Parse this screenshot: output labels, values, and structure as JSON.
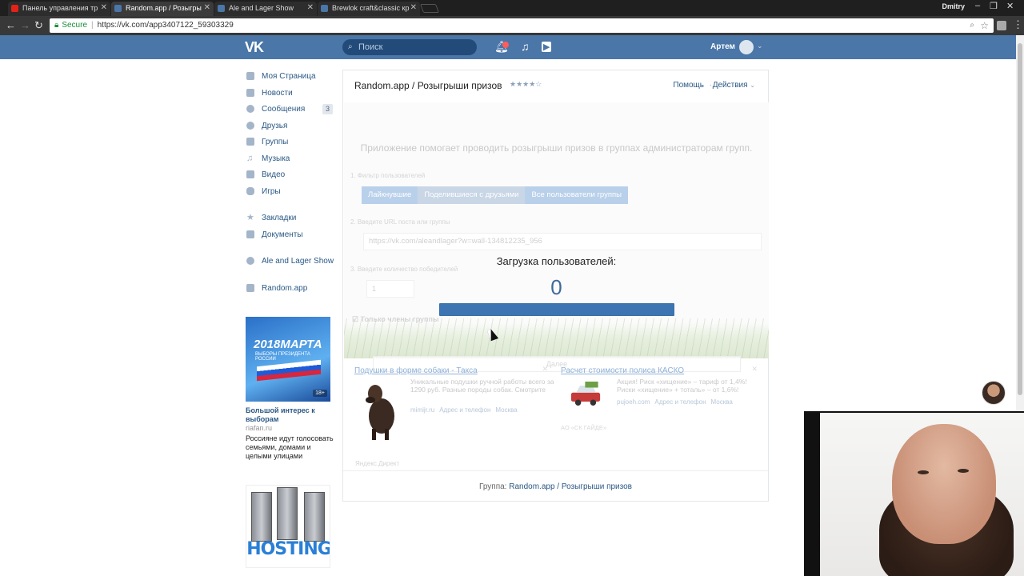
{
  "browser": {
    "tabs": [
      {
        "title": "Панель управления тр",
        "color": "#e62117"
      },
      {
        "title": "Random.app / Розыгры",
        "color": "#4a76a8"
      },
      {
        "title": "Ale and Lager Show",
        "color": "#4a76a8"
      },
      {
        "title": "Brewlok craft&classic кр",
        "color": "#4a76a8"
      }
    ],
    "active_tab": 1,
    "user": "Dmitry",
    "secure_label": "Secure",
    "url": "https://vk.com/app3407122_59303329"
  },
  "vk_header": {
    "logo": "VK",
    "search_placeholder": "Поиск",
    "user_name": "Артем"
  },
  "nav": {
    "items": [
      {
        "label": "Моя Страница"
      },
      {
        "label": "Новости"
      },
      {
        "label": "Сообщения",
        "badge": "3"
      },
      {
        "label": "Друзья"
      },
      {
        "label": "Группы"
      },
      {
        "label": "Музыка"
      },
      {
        "label": "Видео"
      },
      {
        "label": "Игры"
      }
    ],
    "items2": [
      {
        "label": "Закладки"
      },
      {
        "label": "Документы"
      }
    ],
    "items3": [
      {
        "label": "Ale and Lager Show"
      }
    ],
    "items4": [
      {
        "label": "Random.app"
      }
    ]
  },
  "left_ads": {
    "banner_big": "2018МАРТА",
    "banner_small": "ВЫБОРЫ ПРЕЗИДЕНТА РОССИИ",
    "banner_age": "18+",
    "title": "Большой интерес к выборам",
    "domain": "riafan.ru",
    "desc": "Россияне идут голосовать семьями, домами и целыми улицами",
    "hosting_word": "HOSTING"
  },
  "app": {
    "title": "Random.app / Розыгрыши призов",
    "stars": "★★★★☆",
    "help": "Помощь",
    "actions": "Действия",
    "description": "Приложение помогает проводить розыгрыши призов в группах администраторам групп.",
    "step1": "1. Фильтр пользователей",
    "filters": [
      "Лайкнувшие",
      "Поделившиеся с друзьями",
      "Все пользователи группы"
    ],
    "step2": "2. Введите URL поста или группы",
    "url_value": "https://vk.com/aleandlager?w=wall-134812235_956",
    "step3": "3. Введите количество победителей",
    "winners": "1",
    "members_only": "Только члены группы",
    "next": "Далее",
    "loading_title": "Загрузка пользователей:",
    "loading_count": "0",
    "progress_percent": 100
  },
  "yandex_direct": {
    "ad1": {
      "title": "Подушки в форме собаки - Такса",
      "text": "Уникальные подушки ручной работы всего за 1290 руб. Разные породы собак. Смотрите",
      "links": [
        "mimijr.ru",
        "Адрес и телефон",
        "Москва"
      ]
    },
    "ad2": {
      "title": "Расчет стоимости полиса КАСКО",
      "text": "Акция! Риск «хищение» – тариф от 1,4%! Риски «хищение» + тоталь» – от 1,6%!",
      "links": [
        "pujoeh.com",
        "Адрес и телефон",
        "Москва"
      ],
      "sub": "АО «СК ГАЙДЕ»"
    },
    "brand": "Яндекс.Директ"
  },
  "footer": {
    "prefix": "Группа:",
    "group": "Random.app / Розыгрыши призов"
  }
}
